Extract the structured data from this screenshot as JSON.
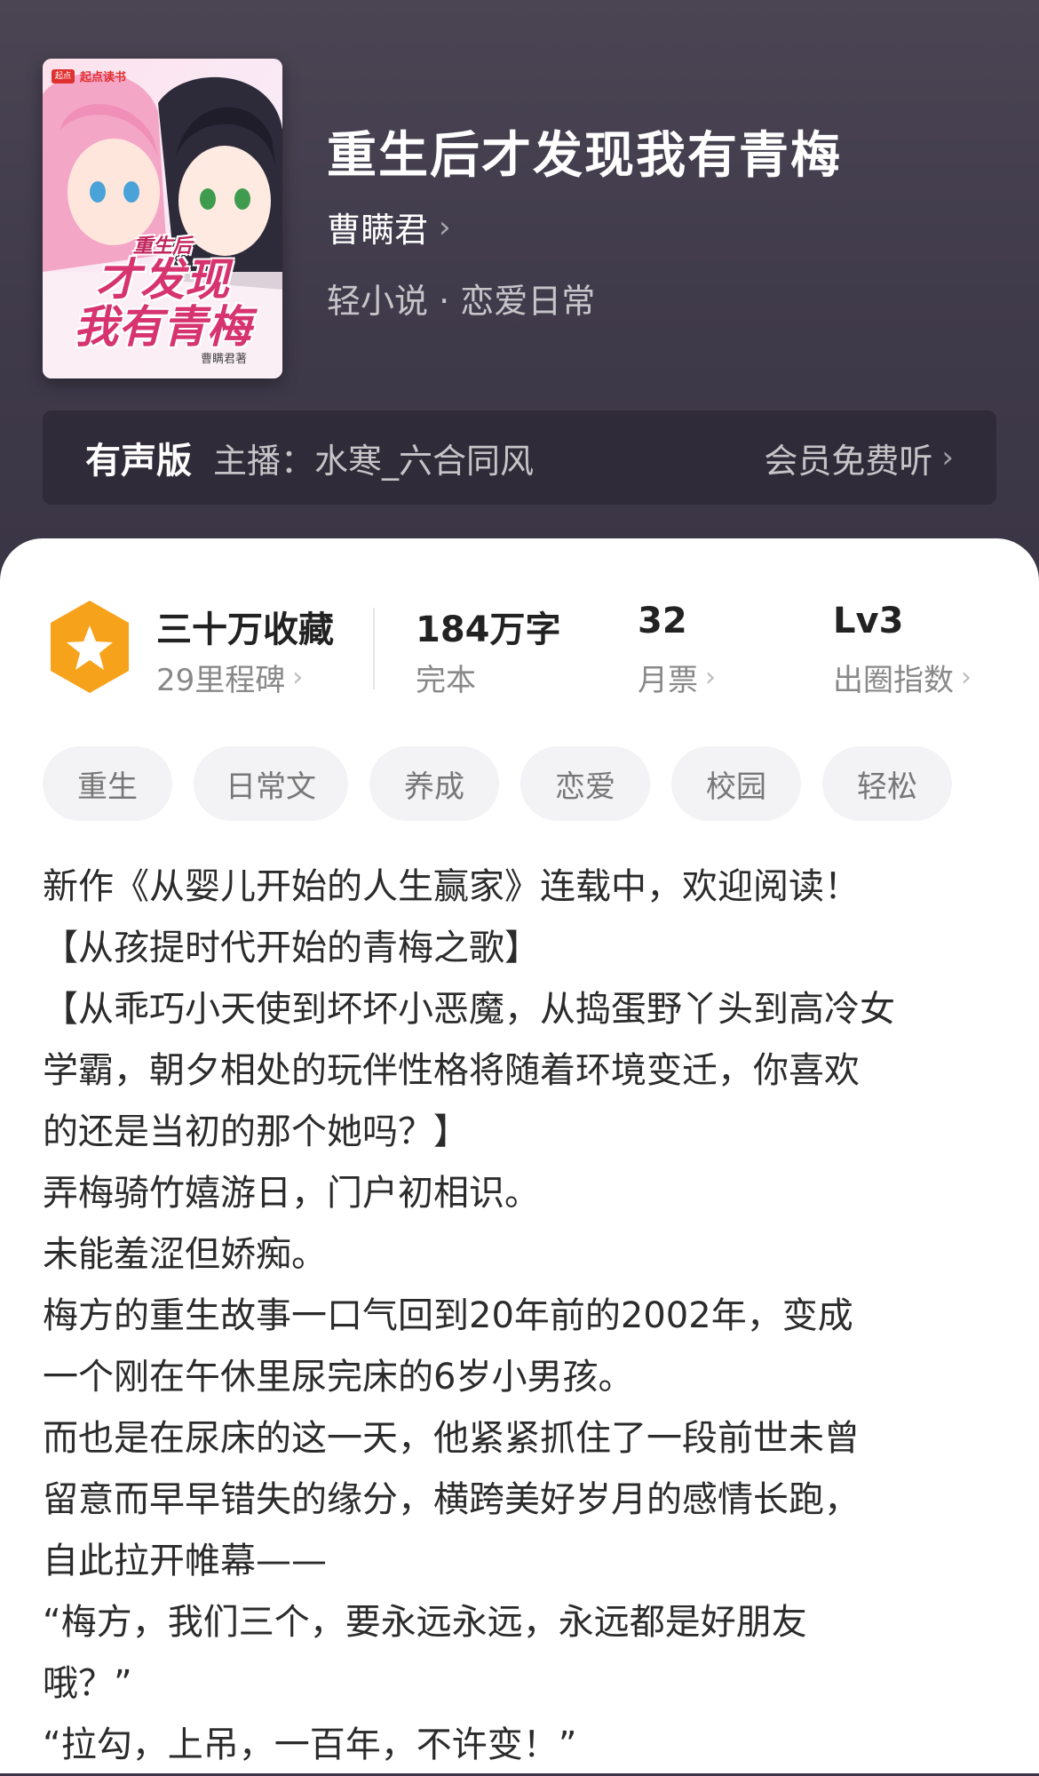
{
  "book": {
    "title": "重生后才发现我有青梅",
    "author": "曹瞒君",
    "category": "轻小说 · 恋爱日常",
    "cover": {
      "brand_badge": "起点",
      "brand": "起点读书",
      "title_small": "重生后",
      "title_line1": "才发现",
      "title_line2": "我有青梅",
      "author": "曹瞒君著"
    }
  },
  "audio": {
    "label": "有声版",
    "host": "主播：水寒_六合同风",
    "vip": "会员免费听"
  },
  "stats": {
    "collect_main": "三十万收藏",
    "collect_sub": "29里程碑",
    "words_main": "184万字",
    "words_sub": "完本",
    "monthly_main": "32",
    "monthly_sub": "月票",
    "level_main": "Lv3",
    "level_sub": "出圈指数"
  },
  "tags": [
    "重生",
    "日常文",
    "养成",
    "恋爱",
    "校园",
    "轻松"
  ],
  "description": [
    "新作《从婴儿开始的人生赢家》连载中，欢迎阅读！",
    "【从孩提时代开始的青梅之歌】",
    "【从乖巧小天使到坏坏小恶魔，从捣蛋野丫头到高冷女",
    "学霸，朝夕相处的玩伴性格将随着环境变迁，你喜欢",
    "的还是当初的那个她吗？】",
    "弄梅骑竹嬉游日，门户初相识。",
    "未能羞涩但娇痴。",
    "梅方的重生故事一口气回到20年前的2002年，变成",
    "一个刚在午休里尿完床的6岁小男孩。",
    "而也是在尿床的这一天，他紧紧抓住了一段前世未曾",
    "留意而早早错失的缘分，横跨美好岁月的感情长跑，",
    "自此拉开帷幕——",
    "“梅方，我们三个，要永远永远，永远都是好朋友",
    "哦？”",
    "“拉勾，上吊，一百年，不许变！”"
  ],
  "icons": {
    "chevron": "chevron-right-icon",
    "badge": "star-badge-icon"
  },
  "colors": {
    "header_bg": "#423d4d",
    "badge_orange": "#f7a21b",
    "text_dark": "#222222"
  }
}
